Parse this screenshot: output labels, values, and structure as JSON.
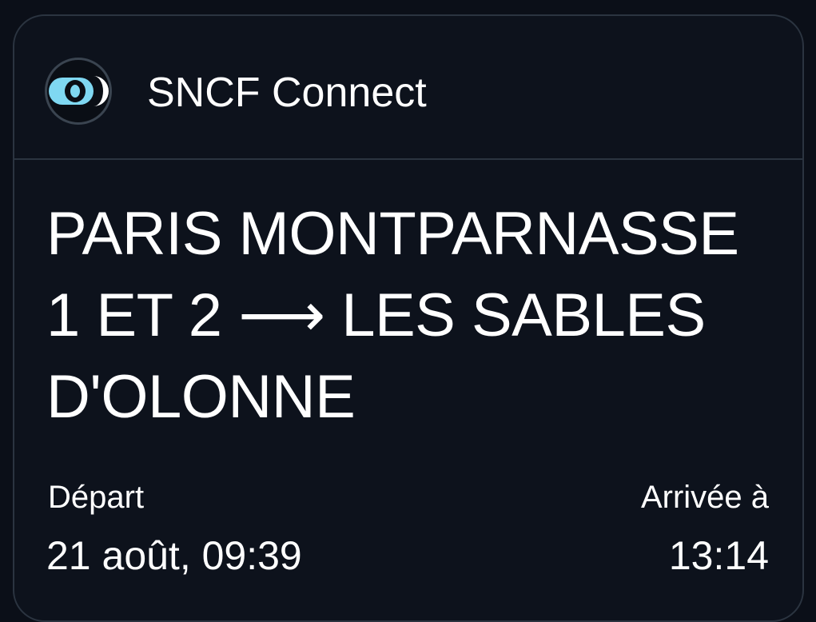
{
  "header": {
    "app_name": "SNCF Connect",
    "logo_icon": "sncf-connect-logo-icon",
    "accent_color": "#7fd8f2"
  },
  "route": {
    "line1": "PARIS MONTPARNASSE",
    "line2": "1 ET 2 ⟶ LES SABLES",
    "line3": "D'OLONNE"
  },
  "departure": {
    "label": "Départ",
    "value": "21 août, 09:39"
  },
  "arrival": {
    "label": "Arrivée à",
    "value": "13:14"
  }
}
